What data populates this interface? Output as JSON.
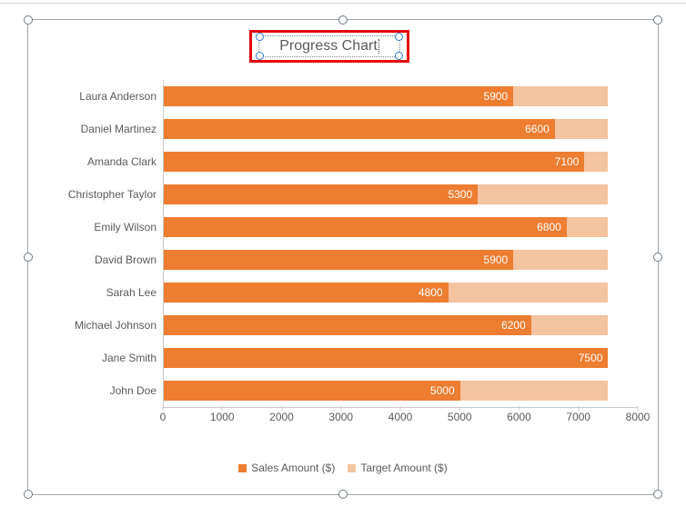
{
  "chart_data": {
    "type": "bar",
    "title": "Progress Chart",
    "xlabel": "",
    "ylabel": "",
    "xlim": [
      0,
      8000
    ],
    "x_ticks": [
      0,
      1000,
      2000,
      3000,
      4000,
      5000,
      6000,
      7000,
      8000
    ],
    "categories": [
      "Laura Anderson",
      "Daniel Martinez",
      "Amanda Clark",
      "Christopher Taylor",
      "Emily Wilson",
      "David Brown",
      "Sarah Lee",
      "Michael Johnson",
      "Jane Smith",
      "John Doe"
    ],
    "series": [
      {
        "name": "Sales Amount ($)",
        "values": [
          5900,
          6600,
          7100,
          5300,
          6800,
          5900,
          4800,
          6200,
          7500,
          5000
        ],
        "color": "#ed7d31"
      },
      {
        "name": "Target Amount ($)",
        "values": [
          7500,
          7500,
          7500,
          7500,
          7500,
          7500,
          7500,
          7500,
          7500,
          7500
        ],
        "color": "#f4c39f"
      }
    ],
    "legend_position": "bottom",
    "grid": false
  }
}
